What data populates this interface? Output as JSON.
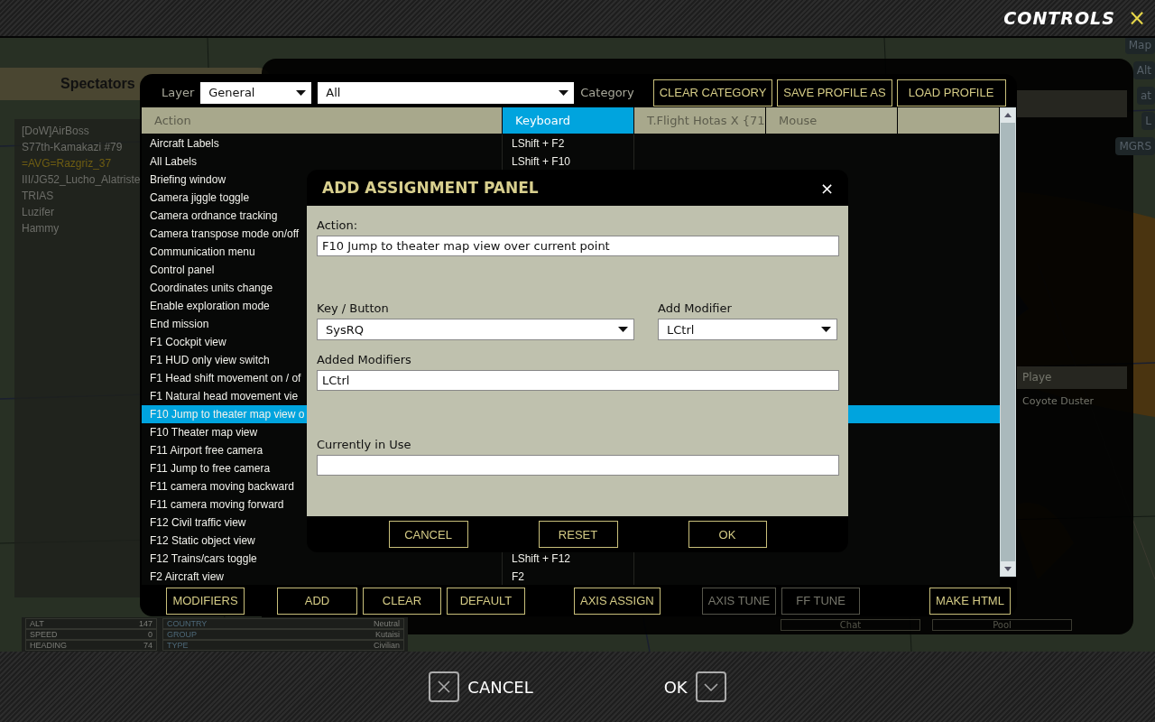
{
  "window": {
    "title": "CONTROLS",
    "close": "×"
  },
  "background": {
    "spectators": {
      "title": "Spectators",
      "players": [
        {
          "name": "[DoW]AirBoss",
          "highlighted": false
        },
        {
          "name": "S77th-Kamakazi #79",
          "highlighted": false
        },
        {
          "name": "=AVG=Razgriz_37",
          "highlighted": true
        },
        {
          "name": "III/JG52_Lucho_Alatriste",
          "highlighted": false
        },
        {
          "name": "TRIAS",
          "highlighted": false
        },
        {
          "name": "Luzifer",
          "highlighted": false
        },
        {
          "name": "Hammy",
          "highlighted": false
        }
      ]
    },
    "map_buttons": [
      "Map",
      "Alt",
      "at",
      "L",
      "MGRS"
    ],
    "players": {
      "column": "Playe",
      "rows": [
        "Coyote Duster"
      ]
    },
    "buttons": [
      "Chat",
      "Pool"
    ],
    "flight_info": [
      {
        "label": "ALT",
        "value": "147"
      },
      {
        "label": "SPEED",
        "value": "0"
      },
      {
        "label": "HEADING",
        "value": "74"
      }
    ],
    "unit_info": [
      {
        "label": "COUNTRY",
        "value": "Neutral"
      },
      {
        "label": "GROUP",
        "value": "Kutaisi"
      },
      {
        "label": "TYPE",
        "value": "Civilian"
      }
    ]
  },
  "controls": {
    "layer_label": "Layer",
    "layer": "General",
    "category": "All",
    "category_label": "Category",
    "toolbar_buttons": [
      "CLEAR CATEGORY",
      "SAVE PROFILE AS",
      "LOAD PROFILE"
    ],
    "columns": [
      {
        "label": "Action",
        "selected": false
      },
      {
        "label": "Keyboard",
        "selected": true
      },
      {
        "label": "T.Flight Hotas X {71",
        "selected": false
      },
      {
        "label": "Mouse",
        "selected": false
      }
    ],
    "rows": [
      {
        "action": "Aircraft Labels",
        "keyboard": "LShift + F2",
        "selected": false
      },
      {
        "action": "All Labels",
        "keyboard": "LShift + F10",
        "selected": false
      },
      {
        "action": "Briefing window",
        "selected": false
      },
      {
        "action": "Camera jiggle toggle",
        "selected": false
      },
      {
        "action": "Camera ordnance tracking",
        "selected": false
      },
      {
        "action": "Camera transpose mode on/off",
        "selected": false
      },
      {
        "action": "Communication menu",
        "selected": false
      },
      {
        "action": "Control panel",
        "selected": false
      },
      {
        "action": "Coordinates units change",
        "selected": false
      },
      {
        "action": "Enable exploration mode",
        "selected": false
      },
      {
        "action": "End mission",
        "selected": false
      },
      {
        "action": "F1 Cockpit view",
        "selected": false
      },
      {
        "action": "F1 HUD only view switch",
        "selected": false
      },
      {
        "action": "F1 Head shift movement on / of",
        "selected": false
      },
      {
        "action": "F1 Natural head movement vie",
        "selected": false
      },
      {
        "action": "F10 Jump to theater map view o",
        "selected": true
      },
      {
        "action": "F10 Theater map view",
        "selected": false
      },
      {
        "action": "F11 Airport free camera",
        "selected": false
      },
      {
        "action": "F11 Jump to free camera",
        "selected": false
      },
      {
        "action": "F11 camera moving backward",
        "selected": false
      },
      {
        "action": "F11 camera moving forward",
        "selected": false
      },
      {
        "action": "F12 Civil traffic view",
        "selected": false
      },
      {
        "action": "F12 Static object view",
        "selected": false
      },
      {
        "action": "F12 Trains/cars toggle",
        "keyboard": "LShift + F12",
        "selected": false
      },
      {
        "action": "F2 Aircraft view",
        "keyboard": "F2",
        "selected": false
      }
    ],
    "buttons": [
      {
        "label": "MODIFIERS",
        "disabled": false
      },
      {
        "label": "ADD",
        "disabled": false
      },
      {
        "label": "CLEAR",
        "disabled": false
      },
      {
        "label": "DEFAULT",
        "disabled": false
      },
      {
        "label": "AXIS ASSIGN",
        "disabled": false
      },
      {
        "label": "AXIS TUNE",
        "disabled": true
      },
      {
        "label": "FF TUNE",
        "disabled": true
      },
      {
        "label": "MAKE HTML",
        "disabled": false
      }
    ]
  },
  "dialog": {
    "title": "ADD ASSIGNMENT PANEL",
    "close": "×",
    "action_label": "Action:",
    "action": "F10 Jump to theater map view over current point",
    "key_label": "Key / Button",
    "key": "SysRQ",
    "modifier_label": "Add Modifier",
    "modifier": "LCtrl",
    "added_label": "Added Modifiers",
    "added": "LCtrl",
    "in_use_label": "Currently in Use",
    "buttons": [
      "CANCEL",
      "RESET",
      "OK"
    ]
  },
  "footer": {
    "cancel": "CANCEL",
    "ok": "OK"
  }
}
